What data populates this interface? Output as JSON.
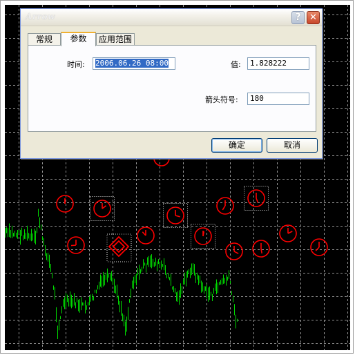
{
  "dialog": {
    "title": "Arrow",
    "help_glyph": "?",
    "close_glyph": "✕",
    "tabs": [
      {
        "label": "常规"
      },
      {
        "label": "参数"
      },
      {
        "label": "应用范围"
      }
    ],
    "active_tab": "参数",
    "fields": {
      "time_label": "时间:",
      "time_value": "2006.06.26 08:00",
      "value_label": "值:",
      "value_value": "1.828222",
      "arrow_code_label": "箭头符号:",
      "arrow_code_value": "180"
    },
    "buttons": {
      "ok": "确定",
      "cancel": "取消"
    }
  },
  "chart": {
    "background": "#000000",
    "grid_color": "#c8c8c8",
    "price_line_color": "#00dd00",
    "marker_color": "#ff0000",
    "marker_icon": "clock-icon"
  }
}
